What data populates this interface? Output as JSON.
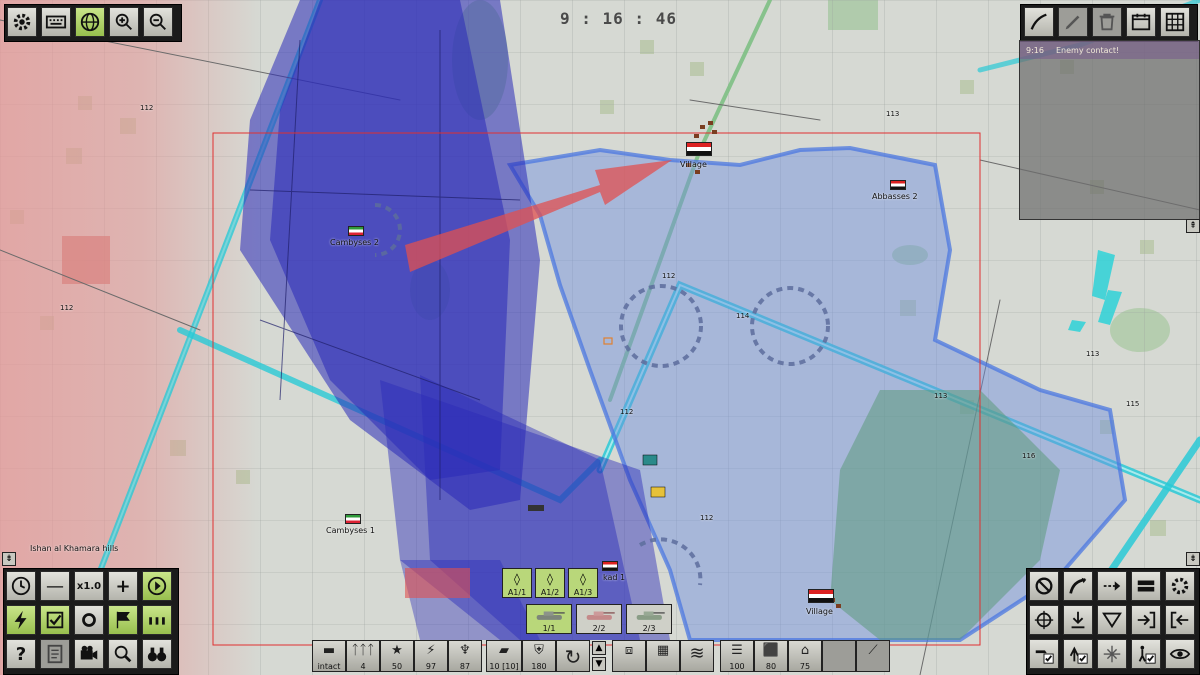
{
  "clock": "9 : 16 : 46",
  "message_log": {
    "entries": [
      {
        "time": "9:16",
        "text": "Enemy contact!"
      }
    ]
  },
  "units": {
    "cambyses_2": "Cambyses 2",
    "cambyses_1": "Cambyses 1",
    "village_top": "Village",
    "abbasses_2": "Abbasses 2",
    "kad_1": "kad 1",
    "village_bottom": "Village",
    "place_name": "Ishan al Khamara hills"
  },
  "elevations": [
    "112",
    "112",
    "112",
    "113",
    "113",
    "113",
    "114",
    "115",
    "116",
    "112",
    "112"
  ],
  "speed": "x1.0",
  "stats": {
    "state": "intact",
    "men": "4",
    "experience": "50",
    "fatigue": "97",
    "morale": "87",
    "ammo": "10 [10]",
    "supply": "180",
    "fuel": "100",
    "condition": "80",
    "leader": "75"
  },
  "subunits": {
    "infantry": [
      "A1/1",
      "A1/2",
      "A1/3"
    ],
    "tanks": [
      "1/1",
      "2/2",
      "2/3"
    ]
  },
  "icons": {
    "top_left": [
      "gear-icon",
      "keyboard-icon",
      "globe-icon",
      "zoom-in-icon",
      "zoom-out-icon"
    ],
    "top_right": [
      "draw-icon",
      "pencil-icon",
      "trash-icon",
      "calendar-icon",
      "grid-icon"
    ]
  },
  "colors": {
    "friendly_zone": "#6f8fe0",
    "enemy_zone": "#e07a7a",
    "fire_arc": "#2a2ab8",
    "road_cyan": "#29c9d6"
  }
}
